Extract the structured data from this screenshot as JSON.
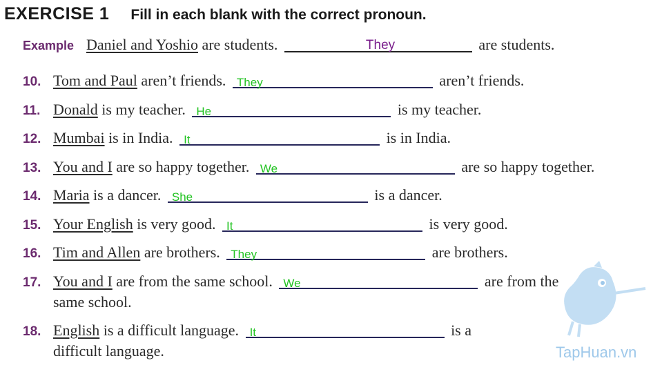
{
  "exercise": {
    "label": "EXERCISE 1",
    "instruction": "Fill in each blank with the correct pronoun."
  },
  "example": {
    "label": "Example",
    "subject": "Daniel and Yoshio",
    "before": "are students.",
    "answer": "They",
    "after": "are students."
  },
  "items": [
    {
      "num": "10.",
      "subject": "Tom and Paul",
      "before": "aren’t friends.",
      "answer": "They",
      "after": "aren’t friends."
    },
    {
      "num": "11.",
      "subject": "Donald",
      "before": "is my teacher.",
      "answer": "He",
      "after": "is my teacher."
    },
    {
      "num": "12.",
      "subject": "Mumbai",
      "before": "is in India.",
      "answer": "It",
      "after": "is in India."
    },
    {
      "num": "13.",
      "subject": "You and I",
      "before": "are so happy together.",
      "answer": "We",
      "after": "are so happy together."
    },
    {
      "num": "14.",
      "subject": "Maria",
      "before": "is a dancer.",
      "answer": "She",
      "after": "is a dancer."
    },
    {
      "num": "15.",
      "subject": "Your English",
      "before": "is very good.",
      "answer": "It",
      "after": "is very good."
    },
    {
      "num": "16.",
      "subject": "Tim and Allen",
      "before": "are brothers.",
      "answer": "They",
      "after": "are brothers."
    },
    {
      "num": "17.",
      "subject": "You and I",
      "before": "are from the same school.",
      "answer": "We",
      "after": "are from the",
      "cont": "same school."
    },
    {
      "num": "18.",
      "subject": "English",
      "before": "is a difficult language.",
      "answer": "It",
      "after": "is a",
      "cont": "difficult language."
    }
  ],
  "watermark": "TapHuan.vn",
  "colors": {
    "number": "#6b2a6e",
    "answer": "#22c322",
    "example_answer": "#7a1f8c",
    "watermark": "#9ec8ea"
  }
}
